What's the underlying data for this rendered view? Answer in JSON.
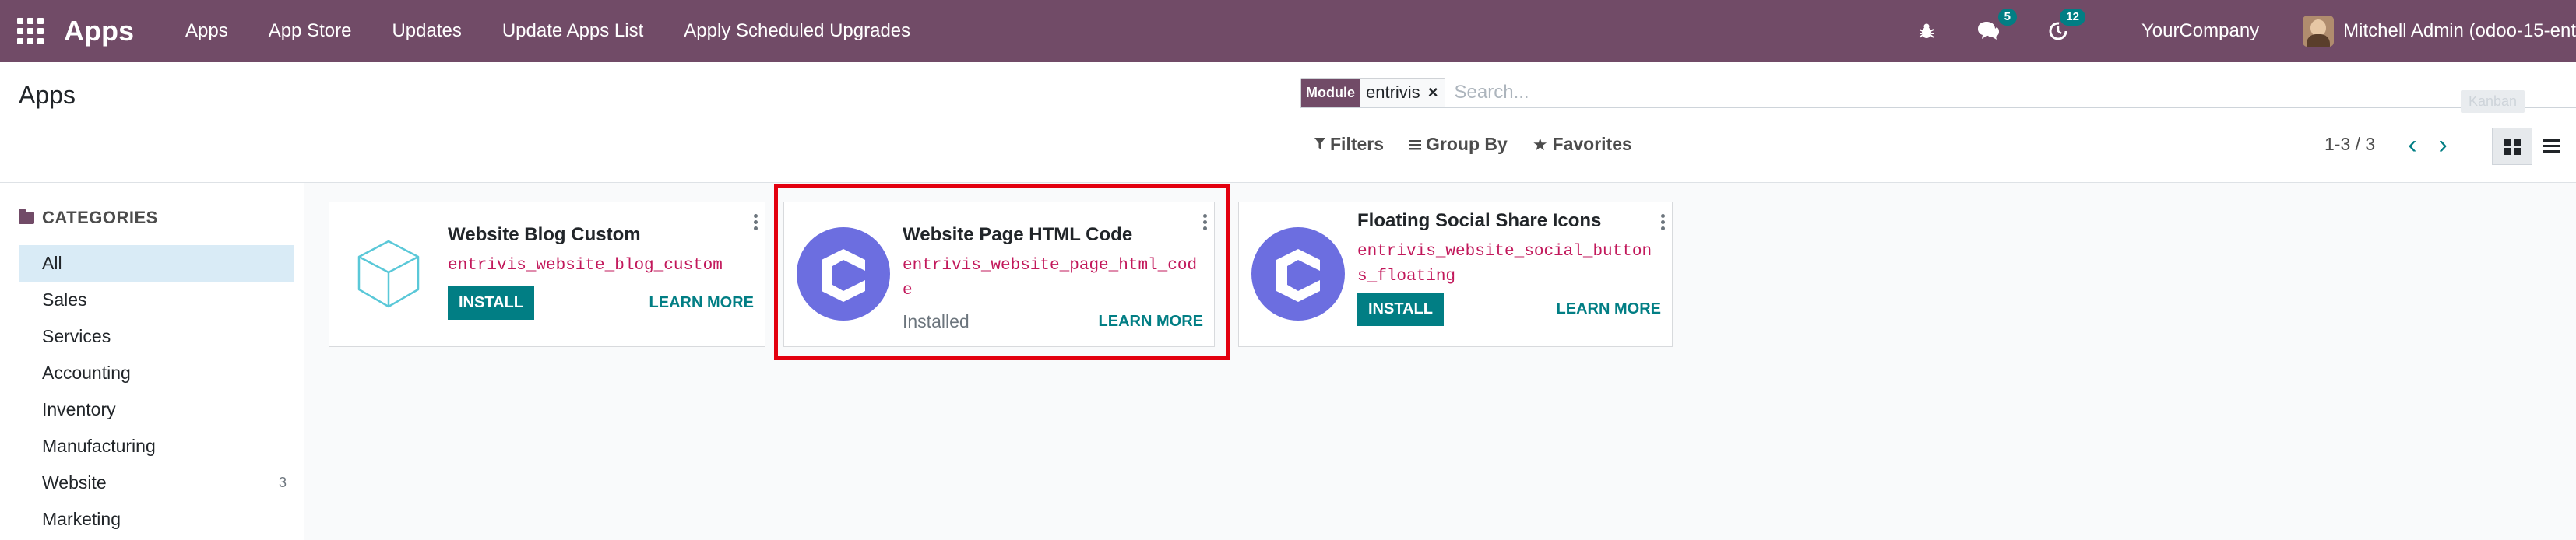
{
  "navbar": {
    "brand": "Apps",
    "menu": [
      "Apps",
      "App Store",
      "Updates",
      "Update Apps List",
      "Apply Scheduled Upgrades"
    ],
    "messages_count": "5",
    "activities_count": "12",
    "company": "YourCompany",
    "user": "Mitchell Admin (odoo-15-ent"
  },
  "control": {
    "title": "Apps",
    "facet_label": "Module",
    "facet_value": "entrivis",
    "search_placeholder": "Search...",
    "tooltip_ghost": "Kanban",
    "filters": "Filters",
    "group_by": "Group By",
    "favorites": "Favorites",
    "pager": "1-3 / 3"
  },
  "sidebar": {
    "header": "CATEGORIES",
    "items": [
      {
        "label": "All",
        "count": ""
      },
      {
        "label": "Sales",
        "count": ""
      },
      {
        "label": "Services",
        "count": ""
      },
      {
        "label": "Accounting",
        "count": ""
      },
      {
        "label": "Inventory",
        "count": ""
      },
      {
        "label": "Manufacturing",
        "count": ""
      },
      {
        "label": "Website",
        "count": "3"
      },
      {
        "label": "Marketing",
        "count": ""
      }
    ]
  },
  "cards": [
    {
      "title": "Website Blog Custom",
      "module": "entrivis_website_blog_custom",
      "action": "INSTALL",
      "more": "LEARN MORE",
      "icon": "cube-icon"
    },
    {
      "title": "Website Page HTML Code",
      "module": "entrivis_website_page_html_code",
      "status": "Installed",
      "more": "LEARN MORE",
      "icon": "entrivis-logo-icon"
    },
    {
      "title": "Floating Social Share Icons",
      "module": "entrivis_website_social_buttons_floating",
      "action": "INSTALL",
      "more": "LEARN MORE",
      "icon": "entrivis-logo-icon"
    }
  ],
  "colors": {
    "navbar": "#714b67",
    "accent": "#017e84",
    "module_text": "#c2185b",
    "highlight": "#e3000f",
    "entrivis_logo": "#6c6ee0"
  }
}
